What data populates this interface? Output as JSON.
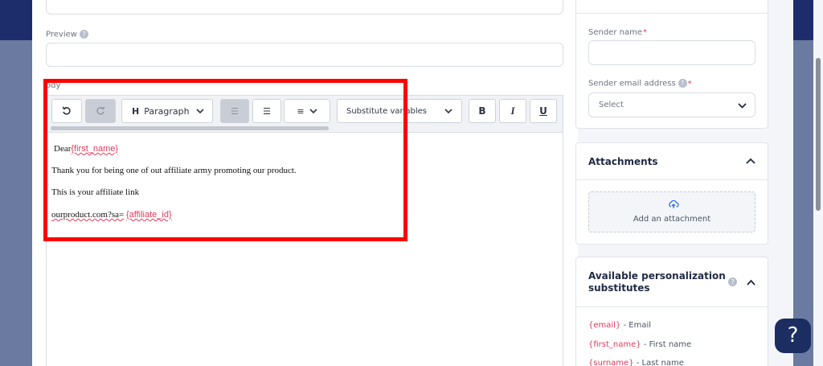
{
  "form": {
    "preview_label": "Preview",
    "body_label": "ody"
  },
  "toolbar": {
    "heading_label": "Paragraph",
    "substitute_label": "Substitute variables",
    "bold": "B",
    "italic": "I",
    "underline": "U"
  },
  "body_content": {
    "line1_text": "Dear",
    "line1_var": "{first_name}",
    "line2": "Thank you for being one of out affiliate army promoting our product.",
    "line3": "This is your affiliate link",
    "line4_text": "ourproduct.com?sa=",
    "line4_var": "{affiliate_id}"
  },
  "sender": {
    "name_label": "Sender name",
    "email_label": "Sender email address",
    "select_placeholder": "Select",
    "required_mark": "*"
  },
  "attachments": {
    "title": "Attachments",
    "add_label": "Add an attachment"
  },
  "personalization": {
    "title": "Available personalization substitutes",
    "items": [
      {
        "token": "{email}",
        "desc": " - Email"
      },
      {
        "token": "{first_name}",
        "desc": " - First name"
      },
      {
        "token": "{surname}",
        "desc": " - Last name"
      }
    ]
  },
  "help_fab": "?",
  "colors": {
    "accent_navy": "#1d2d6c",
    "variable_red": "#e23a5c",
    "highlight_red": "#ff0000"
  }
}
